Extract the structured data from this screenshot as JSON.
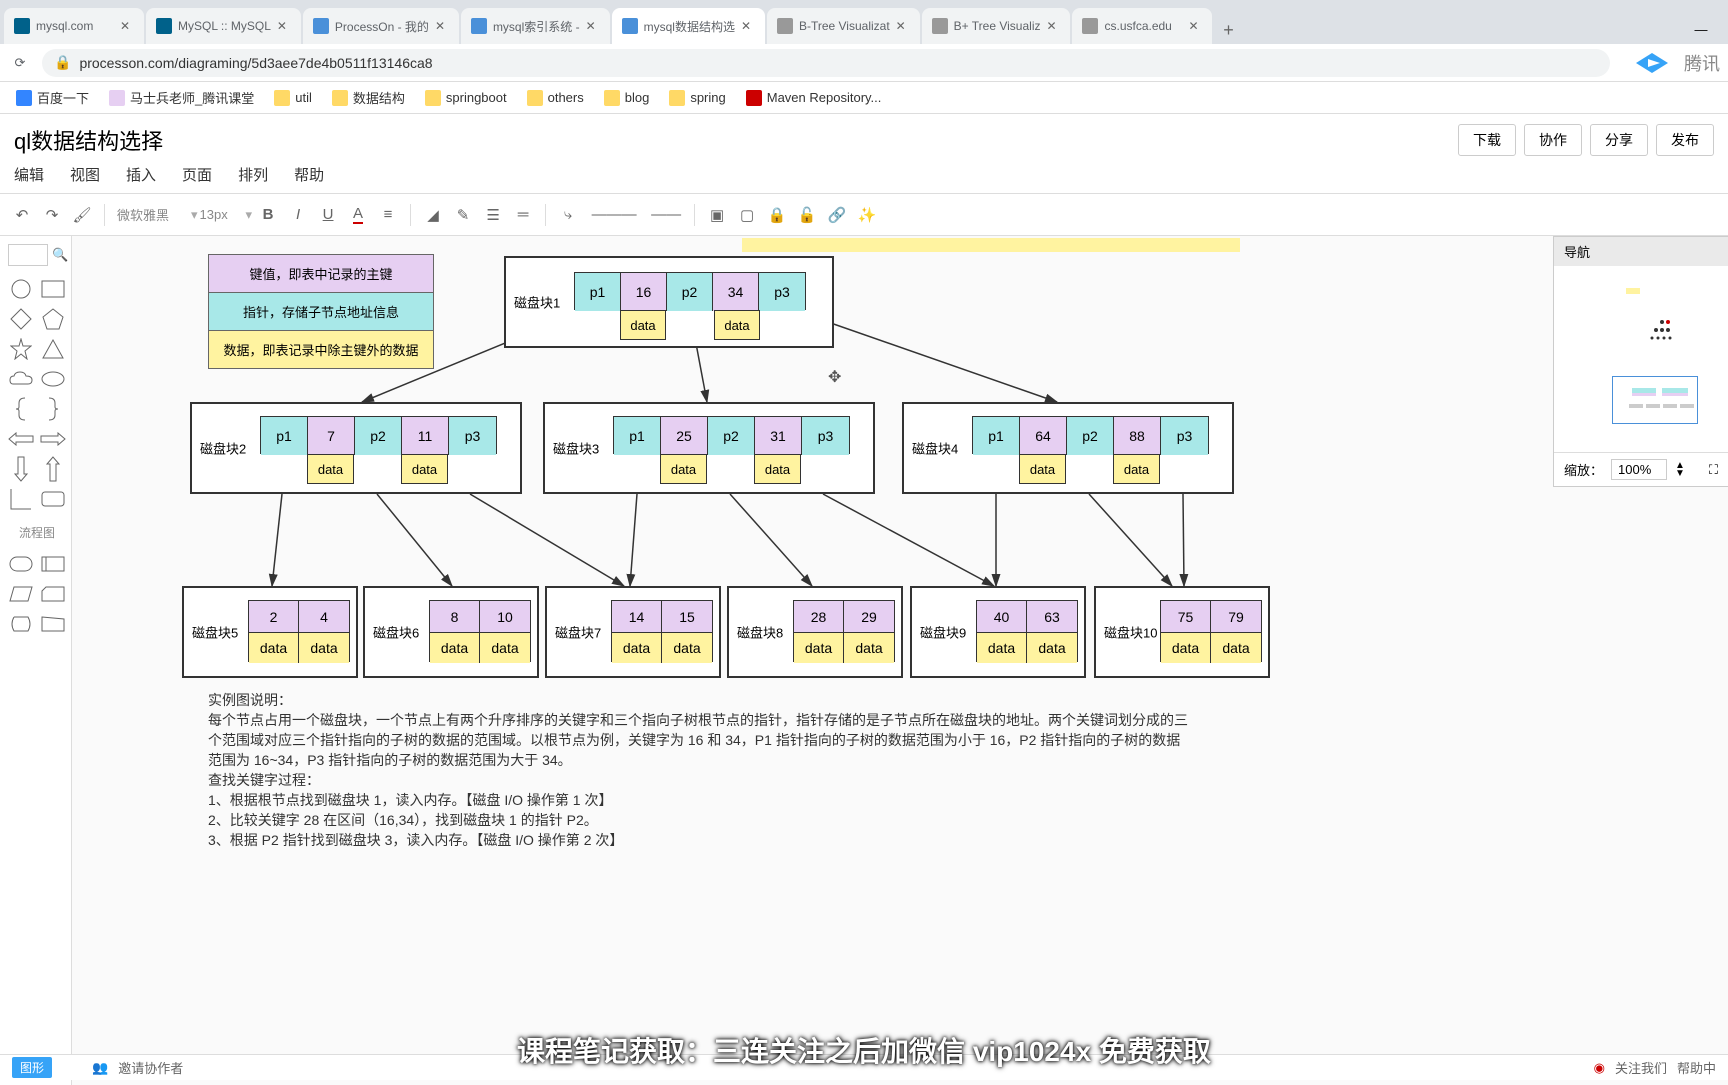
{
  "tabs": [
    {
      "title": "mysql.com",
      "favicon": "#00618a"
    },
    {
      "title": "MySQL :: MySQL",
      "favicon": "#00618a"
    },
    {
      "title": "ProcessOn - 我的",
      "favicon": "#4a90d9"
    },
    {
      "title": "mysql索引系统 -",
      "favicon": "#4a90d9"
    },
    {
      "title": "mysql数据结构选",
      "favicon": "#4a90d9",
      "active": true
    },
    {
      "title": "B-Tree Visualizat",
      "favicon": "#888"
    },
    {
      "title": "B+ Tree Visualiz",
      "favicon": "#888"
    },
    {
      "title": "cs.usfca.edu",
      "favicon": "#888"
    }
  ],
  "url": "processon.com/diagraming/5d3aee7de4b0511f13146ca8",
  "bookmarks": [
    "百度一下",
    "马士兵老师_腾讯课堂",
    "util",
    "数据结构",
    "springboot",
    "others",
    "blog",
    "spring",
    "Maven Repository..."
  ],
  "app": {
    "title": "ql数据结构选择",
    "buttons": [
      "下载",
      "协作",
      "分享",
      "发布"
    ],
    "menus": [
      "编辑",
      "视图",
      "插入",
      "页面",
      "排列",
      "帮助"
    ],
    "font": "微软雅黑",
    "fontsize": "13px"
  },
  "legend": {
    "r1": "键值，即表中记录的主键",
    "r2": "指针，存储子节点地址信息",
    "r3": "数据，即表记录中除主键外的数据"
  },
  "blocks": {
    "b1": {
      "label": "磁盘块1",
      "cells": [
        "p1",
        "16",
        "p2",
        "34",
        "p3"
      ],
      "data": [
        "data",
        "data"
      ]
    },
    "b2": {
      "label": "磁盘块2",
      "cells": [
        "p1",
        "7",
        "p2",
        "11",
        "p3"
      ],
      "data": [
        "data",
        "data"
      ]
    },
    "b3": {
      "label": "磁盘块3",
      "cells": [
        "p1",
        "25",
        "p2",
        "31",
        "p3"
      ],
      "data": [
        "data",
        "data"
      ]
    },
    "b4": {
      "label": "磁盘块4",
      "cells": [
        "p1",
        "64",
        "p2",
        "88",
        "p3"
      ],
      "data": [
        "data",
        "data"
      ]
    },
    "b5": {
      "label": "磁盘块5",
      "cells": [
        "2",
        "4"
      ],
      "data": [
        "data",
        "data"
      ]
    },
    "b6": {
      "label": "磁盘块6",
      "cells": [
        "8",
        "10"
      ],
      "data": [
        "data",
        "data"
      ]
    },
    "b7": {
      "label": "磁盘块7",
      "cells": [
        "14",
        "15"
      ],
      "data": [
        "data",
        "data"
      ]
    },
    "b8": {
      "label": "磁盘块8",
      "cells": [
        "28",
        "29"
      ],
      "data": [
        "data",
        "data"
      ]
    },
    "b9": {
      "label": "磁盘块9",
      "cells": [
        "40",
        "63"
      ],
      "data": [
        "data",
        "data"
      ]
    },
    "b10": {
      "label": "磁盘块10",
      "cells": [
        "75",
        "79"
      ],
      "data": [
        "data",
        "data"
      ]
    }
  },
  "explain": {
    "h": "实例图说明：",
    "p1": "每个节点占用一个磁盘块，一个节点上有两个升序排序的关键字和三个指向子树根节点的指针，指针存储的是子节点所在磁盘块的地址。两个关键词划分成的三个范围域对应三个指针指向的子树的数据的范围域。以根节点为例，关键字为 16 和 34，P1 指针指向的子树的数据范围为小于 16，P2 指针指向的子树的数据范围为 16~34，P3 指针指向的子树的数据范围为大于 34。",
    "p2": "查找关键字过程：",
    "p3": "1、根据根节点找到磁盘块 1，读入内存。【磁盘 I/O 操作第 1 次】",
    "p4": "2、比较关键字 28 在区间（16,34），找到磁盘块 1 的指针 P2。",
    "p5": "3、根据 P2 指针找到磁盘块 3，读入内存。【磁盘 I/O 操作第 2 次】"
  },
  "nav": {
    "label": "导航",
    "zoom_label": "缩放：",
    "zoom": "100%"
  },
  "shapes": {
    "catFlow": "流程图",
    "catTool": "图形"
  },
  "footer": {
    "invite": "邀请协作者",
    "follow": "关注我们",
    "help": "帮助中"
  },
  "caption": "课程笔记获取：三连关注之后加微信 vip1024x 免费获取"
}
